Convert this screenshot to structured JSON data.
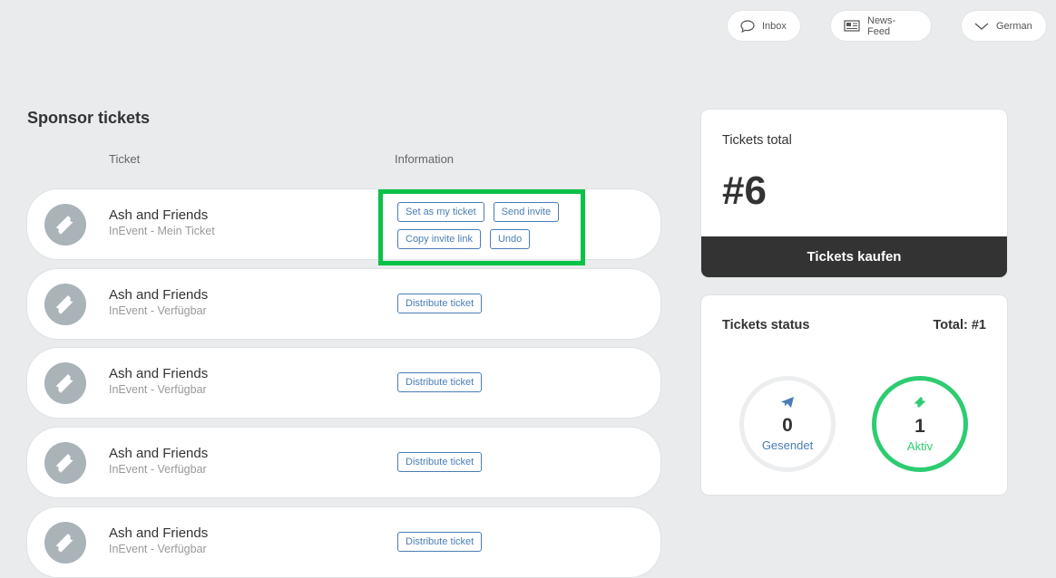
{
  "topbar": {
    "inbox_label": "Inbox",
    "newsfeed_label": "News-Feed",
    "language_label": "German"
  },
  "section": {
    "title": "Sponsor tickets",
    "col_ticket": "Ticket",
    "col_information": "Information"
  },
  "tickets": [
    {
      "name": "Ash and Friends",
      "sub": "InEvent - Mein Ticket",
      "actions": [
        "Set as my ticket",
        "Send invite",
        "Copy invite link",
        "Undo"
      ]
    },
    {
      "name": "Ash and Friends",
      "sub": "InEvent - Verfügbar",
      "actions": [
        "Distribute ticket"
      ]
    },
    {
      "name": "Ash and Friends",
      "sub": "InEvent - Verfügbar",
      "actions": [
        "Distribute ticket"
      ]
    },
    {
      "name": "Ash and Friends",
      "sub": "InEvent - Verfügbar",
      "actions": [
        "Distribute ticket"
      ]
    },
    {
      "name": "Ash and Friends",
      "sub": "InEvent - Verfügbar",
      "actions": [
        "Distribute ticket"
      ]
    }
  ],
  "total_card": {
    "title": "Tickets total",
    "value": "#6",
    "buy_label": "Tickets kaufen"
  },
  "status_card": {
    "title": "Tickets status",
    "total": "Total: #1",
    "sent": {
      "value": "0",
      "label": "Gesendet"
    },
    "active": {
      "value": "1",
      "label": "Aktiv"
    }
  },
  "colors": {
    "accent_blue": "#4a7db5",
    "active_green": "#2ecc71",
    "highlight_green": "#09c247",
    "dark_button": "#333333"
  },
  "icons": {
    "inbox": "speech-bubble-icon",
    "newsfeed": "newspaper-icon",
    "language": "chevron-down-icon",
    "ticket": "ticket-icon",
    "sent": "paper-plane-icon",
    "active": "ticket-icon"
  }
}
